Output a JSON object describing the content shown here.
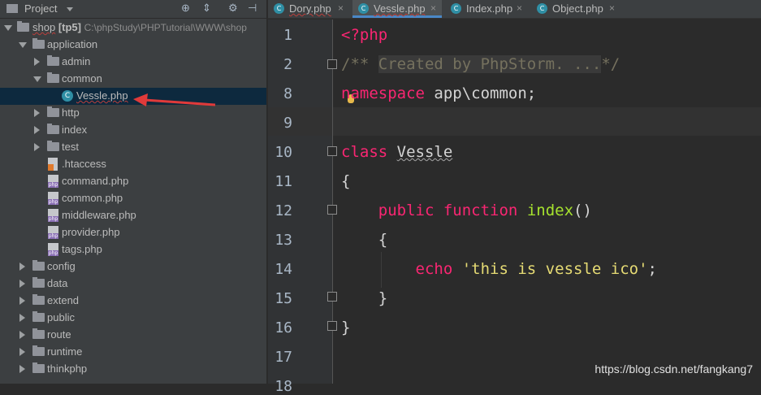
{
  "sidebar": {
    "title": "Project",
    "tree": [
      {
        "label": "shop",
        "suffix": "[tp5]",
        "path": "C:\\phpStudy\\PHPTutorial\\WWW\\shop",
        "type": "root"
      },
      {
        "label": "application",
        "type": "folder-open"
      },
      {
        "label": "admin",
        "type": "folder"
      },
      {
        "label": "common",
        "type": "folder-open"
      },
      {
        "label": "Vessle.php",
        "type": "class",
        "selected": true
      },
      {
        "label": "http",
        "type": "folder"
      },
      {
        "label": "index",
        "type": "folder"
      },
      {
        "label": "test",
        "type": "folder"
      },
      {
        "label": ".htaccess",
        "type": "htaccess"
      },
      {
        "label": "command.php",
        "type": "php"
      },
      {
        "label": "common.php",
        "type": "php"
      },
      {
        "label": "middleware.php",
        "type": "php"
      },
      {
        "label": "provider.php",
        "type": "php"
      },
      {
        "label": "tags.php",
        "type": "php"
      },
      {
        "label": "config",
        "type": "folder"
      },
      {
        "label": "data",
        "type": "folder"
      },
      {
        "label": "extend",
        "type": "folder"
      },
      {
        "label": "public",
        "type": "folder"
      },
      {
        "label": "route",
        "type": "folder"
      },
      {
        "label": "runtime",
        "type": "folder"
      },
      {
        "label": "thinkphp",
        "type": "folder"
      }
    ]
  },
  "tabs": [
    {
      "label": "Dory.php",
      "active": false
    },
    {
      "label": "Vessle.php",
      "active": true
    },
    {
      "label": "Index.php",
      "active": false
    },
    {
      "label": "Object.php",
      "active": false
    }
  ],
  "editor": {
    "line_numbers": [
      "1",
      "2",
      "8",
      "9",
      "10",
      "11",
      "12",
      "13",
      "14",
      "15",
      "16",
      "17",
      "18"
    ],
    "lines": {
      "l1": "<?php",
      "l2_open": "/** ",
      "l2_fold": "Created by PhpStorm. ...",
      "l2_close": "*/",
      "l8_kw": "namespace",
      "l8_rest": " app\\common;",
      "l10_kw": "class",
      "l10_name": "Vessle",
      "l11": "{",
      "l12_kw1": "public",
      "l12_kw2": "function",
      "l12_fn": "index",
      "l12_paren": "()",
      "l13": "{",
      "l14_kw": "echo",
      "l14_str": "'this is vessle ico'",
      "l14_end": ";",
      "l15": "}",
      "l16": "}"
    }
  },
  "watermark": "https://blog.csdn.net/fangkang7",
  "colors": {
    "keyword": "#f92672",
    "function": "#a6e22e",
    "string": "#e6db74",
    "selection": "#0d293e"
  }
}
